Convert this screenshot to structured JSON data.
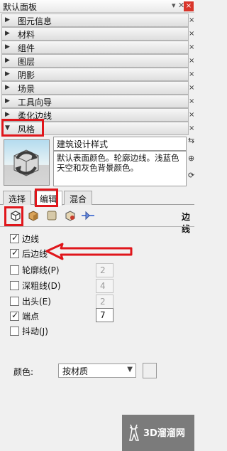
{
  "panel": {
    "title": "默认面板",
    "pin": "▾ ✕",
    "close": "×"
  },
  "trays": [
    {
      "label": "图元信息",
      "expanded": false
    },
    {
      "label": "材料",
      "expanded": false
    },
    {
      "label": "组件",
      "expanded": false
    },
    {
      "label": "图层",
      "expanded": false
    },
    {
      "label": "阴影",
      "expanded": false
    },
    {
      "label": "场景",
      "expanded": false
    },
    {
      "label": "工具向导",
      "expanded": false
    },
    {
      "label": "柔化边线",
      "expanded": false
    },
    {
      "label": "风格",
      "expanded": true
    }
  ],
  "tray_close": "×",
  "style": {
    "name": "建筑设计样式",
    "description": "默认表面颜色。轮廓边线。浅蓝色天空和灰色背景颜色。",
    "side_buttons": [
      "⇆",
      "⊕",
      "⟳"
    ]
  },
  "tabs": [
    {
      "label": "选择",
      "active": false
    },
    {
      "label": "编辑",
      "active": true
    },
    {
      "label": "混合",
      "active": false
    }
  ],
  "edit_icons": [
    "edge-settings-icon",
    "face-settings-icon",
    "background-settings-icon",
    "watermark-settings-icon",
    "modeling-settings-icon"
  ],
  "section_title": "边线",
  "options": [
    {
      "label": "边线",
      "checked": true
    },
    {
      "label": "后边线",
      "checked": true
    },
    {
      "label": "轮廓线(P)",
      "checked": false,
      "value": "2"
    },
    {
      "label": "深粗线(D)",
      "checked": false,
      "value": "4"
    },
    {
      "label": "出头(E)",
      "checked": false,
      "value": "2"
    },
    {
      "label": "端点",
      "checked": true,
      "value": "7"
    },
    {
      "label": "抖动(J)",
      "checked": false
    }
  ],
  "color": {
    "label": "颜色:",
    "selected": "按材质"
  },
  "annotation_color": "#e0161b",
  "watermark": "3D溜溜网"
}
